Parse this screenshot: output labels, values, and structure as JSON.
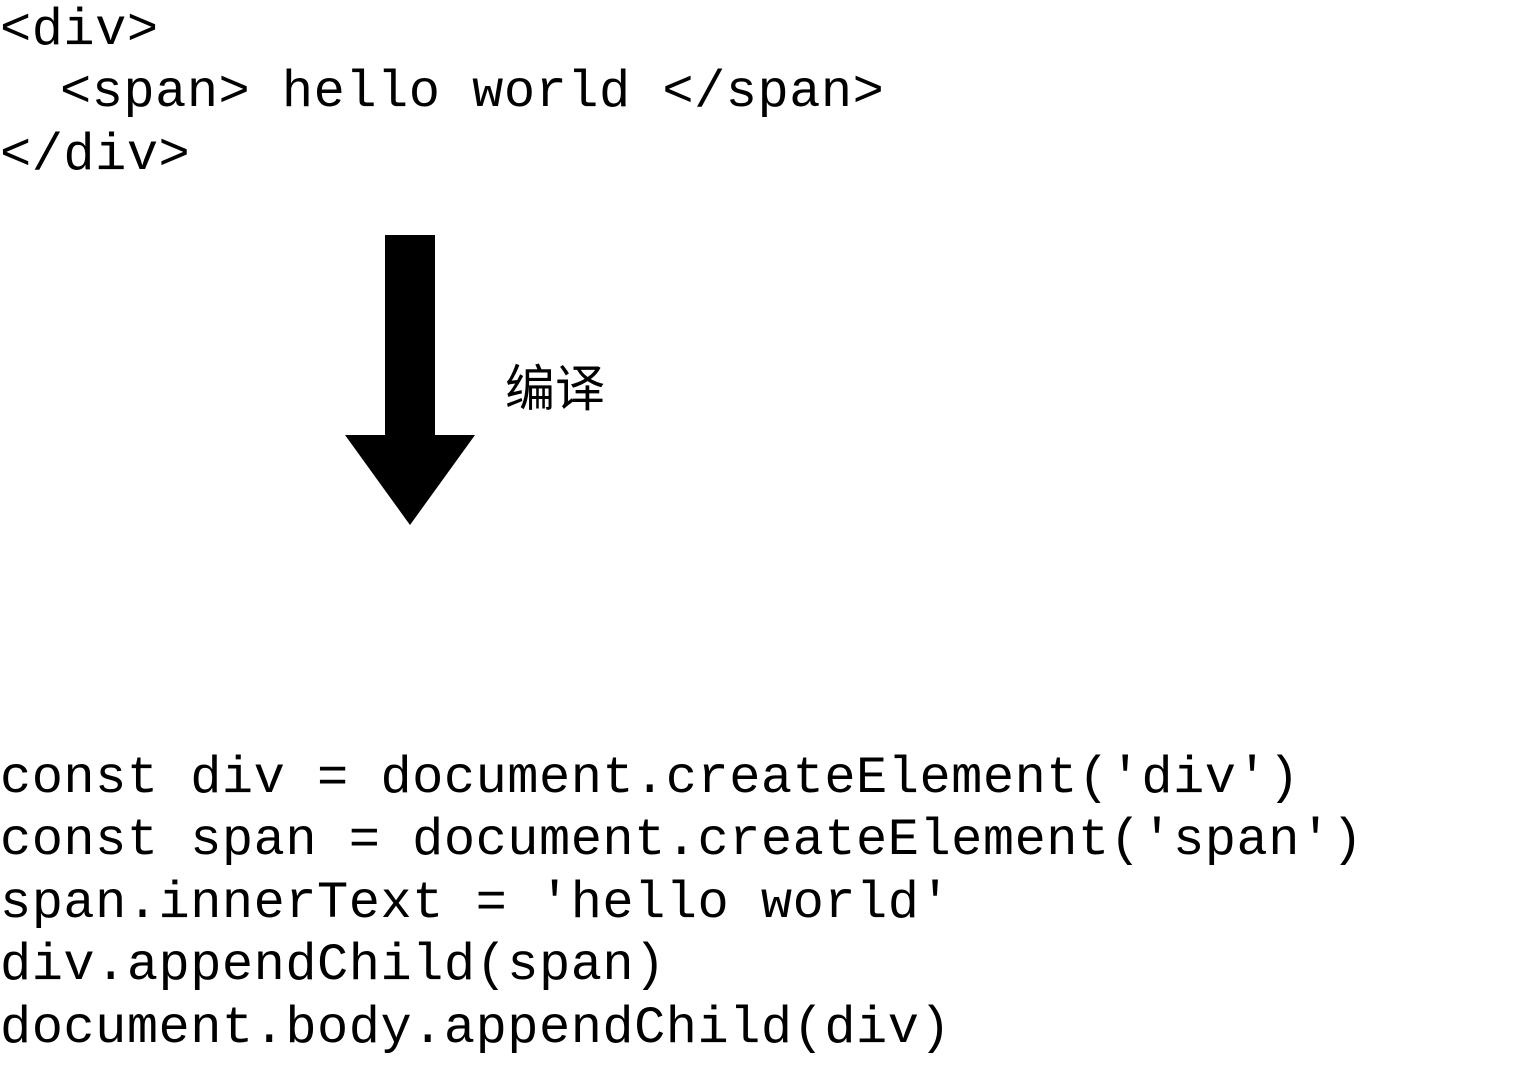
{
  "source_code": {
    "line1": "<div>",
    "line2": "<span> hello world </span>",
    "line3": "</div>"
  },
  "arrow_label": "编译",
  "compiled_code": {
    "line1": "const div = document.createElement('div')",
    "line2": "const span = document.createElement('span')",
    "line3": "span.innerText = 'hello world'",
    "line4": "div.appendChild(span)",
    "line5": "document.body.appendChild(div)"
  }
}
